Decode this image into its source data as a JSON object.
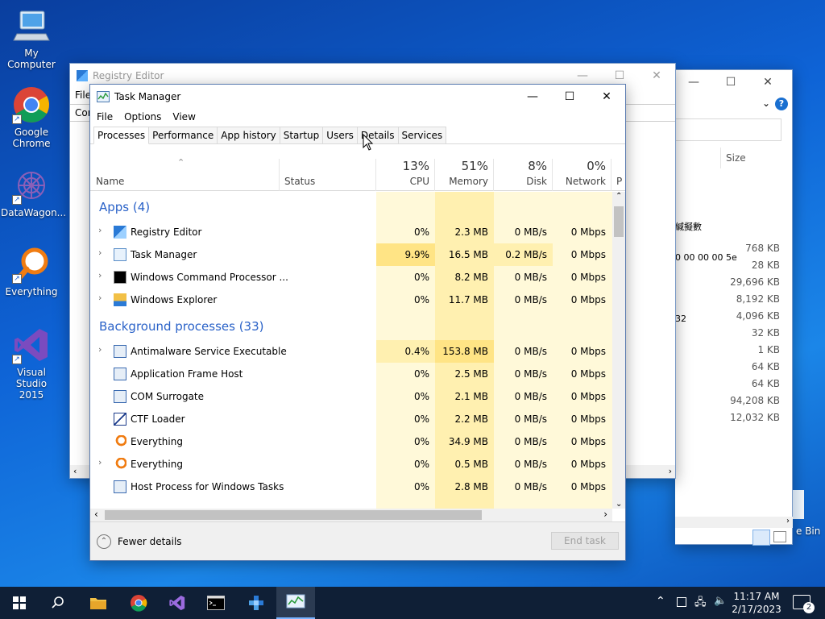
{
  "desktop": {
    "icons": [
      {
        "label": "My Computer"
      },
      {
        "label": "Google\nChrome"
      },
      {
        "label": "DataWagon..."
      },
      {
        "label": "Everything"
      },
      {
        "label": "Visual Studio\n2015"
      }
    ]
  },
  "registry_editor": {
    "title": "Registry Editor",
    "menu_fragment": "File",
    "address_fragment": "Con"
  },
  "explorer": {
    "column_size": "Size",
    "sizes": [
      "768 KB",
      "28 KB",
      "29,696 KB",
      "8,192 KB",
      "4,096 KB",
      "32 KB",
      "1 KB",
      "64 KB",
      "64 KB",
      "94,208 KB",
      "12,032 KB"
    ],
    "frag_text": [
      "緘擬數",
      "0 00 00 00 5e",
      "32"
    ],
    "recycle_fragment": "e Bin"
  },
  "task_manager": {
    "title": "Task Manager",
    "menu": [
      "File",
      "Options",
      "View"
    ],
    "tabs": [
      "Processes",
      "Performance",
      "App history",
      "Startup",
      "Users",
      "Details",
      "Services"
    ],
    "active_tab": "Processes",
    "columns": {
      "name": "Name",
      "status": "Status",
      "cpu": {
        "pct": "13%",
        "label": "CPU"
      },
      "memory": {
        "pct": "51%",
        "label": "Memory"
      },
      "disk": {
        "pct": "8%",
        "label": "Disk"
      },
      "network": {
        "pct": "0%",
        "label": "Network"
      },
      "next": "P"
    },
    "groups": {
      "apps": "Apps (4)",
      "background": "Background processes (33)"
    },
    "apps": [
      {
        "name": "Registry Editor",
        "cpu": "0%",
        "mem": "2.3 MB",
        "disk": "0 MB/s",
        "net": "0 Mbps"
      },
      {
        "name": "Task Manager",
        "cpu": "9.9%",
        "mem": "16.5 MB",
        "disk": "0.2 MB/s",
        "net": "0 Mbps"
      },
      {
        "name": "Windows Command Processor ...",
        "cpu": "0%",
        "mem": "8.2 MB",
        "disk": "0 MB/s",
        "net": "0 Mbps"
      },
      {
        "name": "Windows Explorer",
        "cpu": "0%",
        "mem": "11.7 MB",
        "disk": "0 MB/s",
        "net": "0 Mbps"
      }
    ],
    "background": [
      {
        "name": "Antimalware Service Executable",
        "cpu": "0.4%",
        "mem": "153.8 MB",
        "disk": "0 MB/s",
        "net": "0 Mbps"
      },
      {
        "name": "Application Frame Host",
        "cpu": "0%",
        "mem": "2.5 MB",
        "disk": "0 MB/s",
        "net": "0 Mbps"
      },
      {
        "name": "COM Surrogate",
        "cpu": "0%",
        "mem": "2.1 MB",
        "disk": "0 MB/s",
        "net": "0 Mbps"
      },
      {
        "name": "CTF Loader",
        "cpu": "0%",
        "mem": "2.2 MB",
        "disk": "0 MB/s",
        "net": "0 Mbps"
      },
      {
        "name": "Everything",
        "cpu": "0%",
        "mem": "34.9 MB",
        "disk": "0 MB/s",
        "net": "0 Mbps"
      },
      {
        "name": "Everything",
        "cpu": "0%",
        "mem": "0.5 MB",
        "disk": "0 MB/s",
        "net": "0 Mbps"
      },
      {
        "name": "Host Process for Windows Tasks",
        "cpu": "0%",
        "mem": "2.8 MB",
        "disk": "0 MB/s",
        "net": "0 Mbps"
      }
    ],
    "fewer_details": "Fewer details",
    "end_task": "End task"
  },
  "taskbar": {
    "time": "11:17 AM",
    "date": "2/17/2023",
    "notifications": "2"
  },
  "colors": {
    "accent": "#2a62c8",
    "heat_light": "#fff9d9",
    "heat_mid": "#fff0b0",
    "heat_strong": "#ffe485",
    "taskbar": "#0f1f36"
  }
}
